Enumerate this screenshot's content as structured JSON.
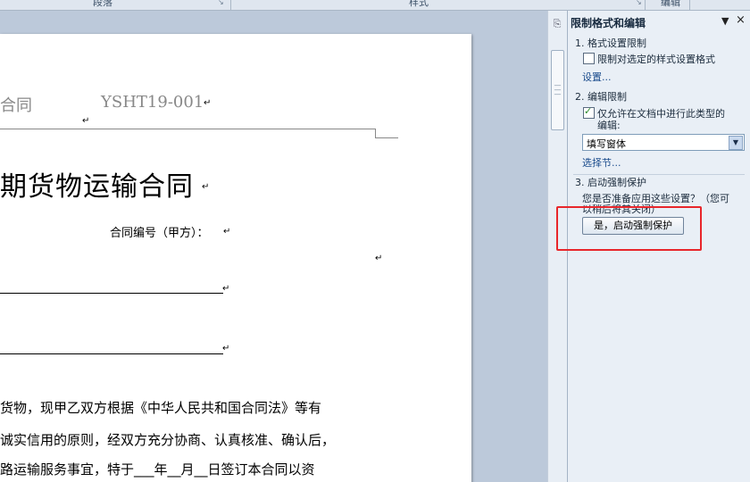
{
  "ribbon": {
    "groups": [
      "段落",
      "样式",
      "编辑"
    ]
  },
  "document": {
    "header_left": "合同",
    "header_code": "YSHT19-001",
    "title": "期货物运输合同",
    "contract_no_label": "合同编号（甲方）：",
    "para_mark": "↵",
    "body_lines": [
      "货物，现甲乙双方根据《中华人民共和国合同法》等有",
      "诚实信用的原则，经双方充分协商、认真核准、确认后，",
      "路运输服务事宜，特于___年__月__日签订本合同以资"
    ]
  },
  "pane": {
    "title": "限制格式和编辑",
    "section1_title": "1. 格式设置限制",
    "section1_checkbox": "限制对选定的样式设置格式",
    "section1_checked": false,
    "section1_link": "设置...",
    "section2_title": "2. 编辑限制",
    "section2_checkbox_line1": "仅允许在文档中进行此类型的",
    "section2_checkbox_line2": "编辑:",
    "section2_checked": true,
    "section2_dropdown_value": "填写窗体",
    "section2_link": "选择节...",
    "section3_title": "3. 启动强制保护",
    "section3_text_line1": "您是否准备应用这些设置？（您可",
    "section3_text_line2": "以稍后将其关闭）",
    "section3_button": "是，启动强制保护",
    "close_glyph": "×",
    "menu_glyph": "▼"
  },
  "colors": {
    "highlight_box": "#e8262b",
    "link": "#1a4b8c"
  }
}
